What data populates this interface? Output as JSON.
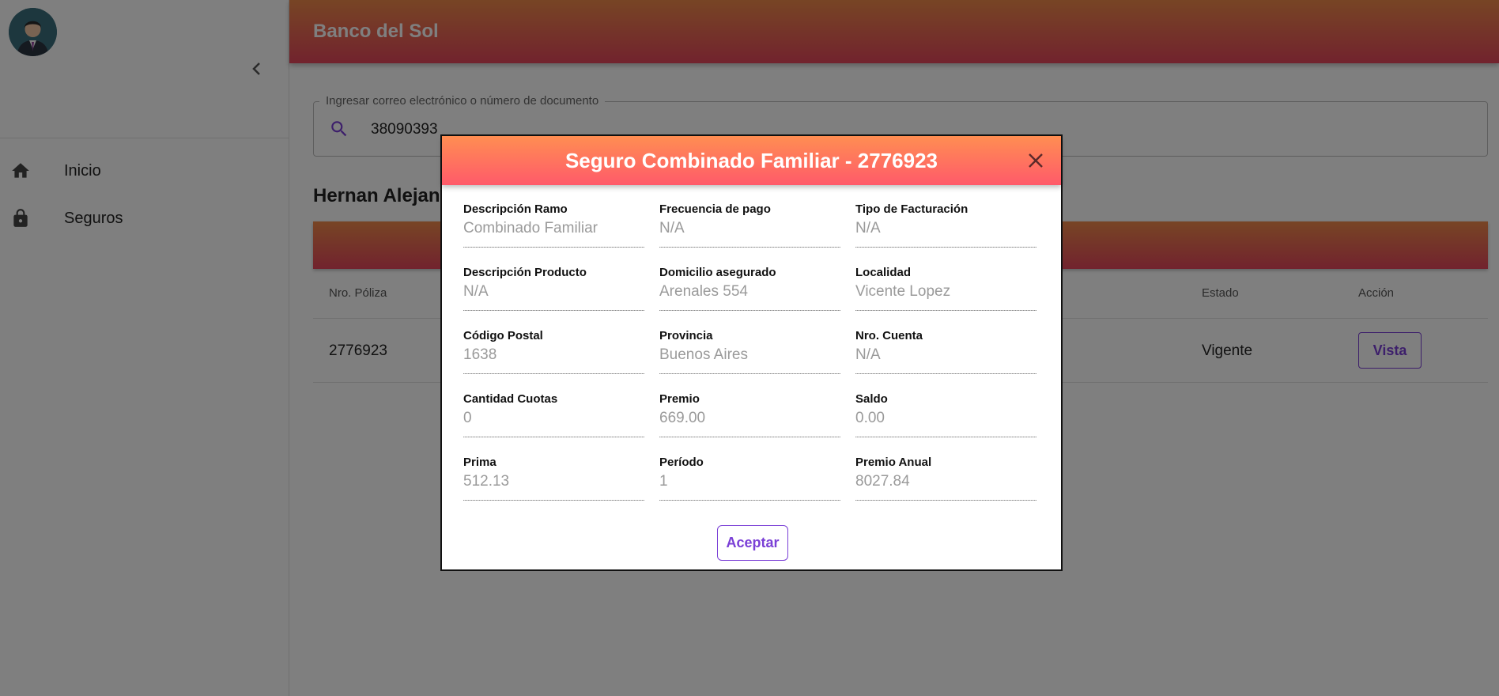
{
  "app": {
    "brand": "Banco del Sol"
  },
  "sidebar": {
    "items": [
      {
        "label": "Inicio",
        "icon": "home-icon"
      },
      {
        "label": "Seguros",
        "icon": "lock-icon"
      }
    ]
  },
  "search": {
    "legend": "Ingresar correo electrónico o número de documento",
    "value": "38090393"
  },
  "client": {
    "name": "Hernan Alejan"
  },
  "table": {
    "headers": {
      "poliza": "Nro. Póliza",
      "estado": "Estado",
      "accion": "Acción"
    },
    "rows": [
      {
        "poliza": "2776923",
        "estado": "Vigente",
        "action_label": "Vista"
      }
    ]
  },
  "modal": {
    "title": "Seguro Combinado Familiar - 2776923",
    "fields": [
      {
        "label": "Descripción Ramo",
        "value": "Combinado Familiar"
      },
      {
        "label": "Frecuencia de pago",
        "value": "N/A"
      },
      {
        "label": "Tipo de Facturación",
        "value": "N/A"
      },
      {
        "label": "Descripción Producto",
        "value": "N/A"
      },
      {
        "label": "Domicilio asegurado",
        "value": "Arenales 554"
      },
      {
        "label": "Localidad",
        "value": "Vicente Lopez"
      },
      {
        "label": "Código Postal",
        "value": "1638"
      },
      {
        "label": "Provincia",
        "value": "Buenos Aires"
      },
      {
        "label": "Nro. Cuenta",
        "value": "N/A"
      },
      {
        "label": "Cantidad Cuotas",
        "value": "0"
      },
      {
        "label": "Premio",
        "value": "669.00"
      },
      {
        "label": "Saldo",
        "value": "0.00"
      },
      {
        "label": "Prima",
        "value": "512.13"
      },
      {
        "label": "Período",
        "value": "1"
      },
      {
        "label": "Premio Anual",
        "value": "8027.84"
      }
    ],
    "accept_label": "Aceptar"
  },
  "colors": {
    "accent": "#7a3fd6",
    "header_gradient_start": "#ef8a4a",
    "header_gradient_end": "#e4465c"
  }
}
